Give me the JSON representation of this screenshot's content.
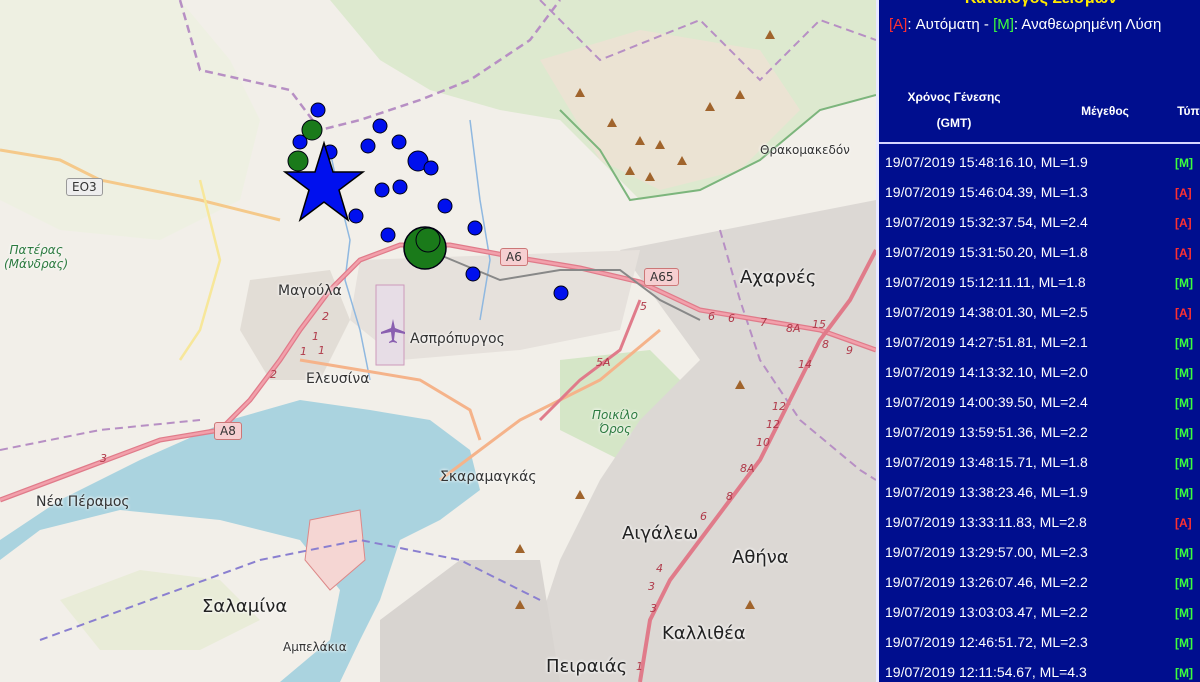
{
  "panel": {
    "title": "Κατάλογος Σεισμών",
    "legend": {
      "auto_tag": "[A]",
      "auto_label": ": Αυτόματη - ",
      "manual_tag": "[M]",
      "manual_label": ": Αναθεωρημένη Λύση"
    },
    "columns": {
      "time_line1": "Χρόνος Γένεσης",
      "time_line2": "(GMT)",
      "magnitude": "Μέγεθος",
      "type": "Τύπος"
    },
    "rows": [
      {
        "text": "19/07/2019 15:48:16.10, ML=1.9",
        "type": "[M]"
      },
      {
        "text": "19/07/2019 15:46:04.39, ML=1.3",
        "type": "[A]"
      },
      {
        "text": "19/07/2019 15:32:37.54, ML=2.4",
        "type": "[A]"
      },
      {
        "text": "19/07/2019 15:31:50.20, ML=1.8",
        "type": "[A]"
      },
      {
        "text": "19/07/2019 15:12:11.11, ML=1.8",
        "type": "[M]"
      },
      {
        "text": "19/07/2019 14:38:01.30, ML=2.5",
        "type": "[A]"
      },
      {
        "text": "19/07/2019 14:27:51.81, ML=2.1",
        "type": "[M]"
      },
      {
        "text": "19/07/2019 14:13:32.10, ML=2.0",
        "type": "[M]"
      },
      {
        "text": "19/07/2019 14:00:39.50, ML=2.4",
        "type": "[M]"
      },
      {
        "text": "19/07/2019 13:59:51.36, ML=2.2",
        "type": "[M]"
      },
      {
        "text": "19/07/2019 13:48:15.71, ML=1.8",
        "type": "[M]"
      },
      {
        "text": "19/07/2019 13:38:23.46, ML=1.9",
        "type": "[M]"
      },
      {
        "text": "19/07/2019 13:33:11.83, ML=2.8",
        "type": "[A]"
      },
      {
        "text": "19/07/2019 13:29:57.00, ML=2.3",
        "type": "[M]"
      },
      {
        "text": "19/07/2019 13:26:07.46, ML=2.2",
        "type": "[M]"
      },
      {
        "text": "19/07/2019 13:03:03.47, ML=2.2",
        "type": "[M]"
      },
      {
        "text": "19/07/2019 12:46:51.72, ML=2.3",
        "type": "[M]"
      },
      {
        "text": "19/07/2019 12:11:54.67, ML=4.3",
        "type": "[M]"
      }
    ]
  },
  "map": {
    "places": {
      "magoula": "Μαγούλα",
      "aspropyrgos": "Ασπρόπυργος",
      "elefsina": "Ελευσίνα",
      "acharnes": "Αχαρνές",
      "skaramagkas": "Σκαραμαγκάς",
      "aigaleo": "Αιγάλεω",
      "athina": "Αθήνα",
      "kallithea": "Καλλιθέα",
      "peiraias": "Πειραιάς",
      "salamina": "Σαλαμίνα",
      "ampelakia": "Αμπελάκια",
      "nea_peramos": "Νέα Πέραμος",
      "thrakomakedones": "Θρακομακεδόν",
      "pateras": "Πατέρας",
      "pateras_sub": "(Μάνδρας)",
      "poikilo": "Ποικίλο",
      "poikilo_sub": "Όρος"
    },
    "roads": {
      "eo3": "ΕΟ3",
      "a6": "Α6",
      "a65": "Α65",
      "a8": "Α8"
    },
    "junctions": [
      "1",
      "1",
      "1",
      "2",
      "2",
      "3",
      "5",
      "5Α",
      "6",
      "6",
      "7",
      "8Α",
      "15",
      "8",
      "9",
      "14",
      "12",
      "12",
      "10",
      "8Α",
      "8",
      "6",
      "4",
      "3",
      "3",
      "1"
    ]
  },
  "colors": {
    "panel_bg": "#000e8e",
    "title": "#ffea00",
    "auto": "#ff3030",
    "manual": "#3cff3c",
    "event_blue": "#0010ee",
    "event_green": "#1a7a1a"
  }
}
